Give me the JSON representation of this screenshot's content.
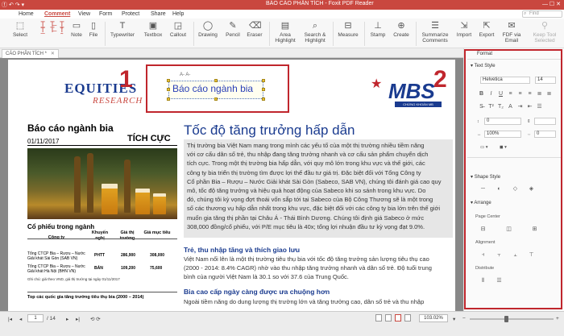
{
  "window": {
    "title": "BÁO CÁO PHÂN TÍCH - Foxit PDF Reader",
    "left_controls": "ⓕ ↶ ↷ ▾",
    "right_controls": "— ☐ ✕"
  },
  "menu": {
    "items": [
      "Home",
      "Comment",
      "View",
      "Form",
      "Protect",
      "Share",
      "Help"
    ],
    "active": "Comment",
    "find_placeholder": "Find"
  },
  "ribbon": {
    "buttons": [
      {
        "label": "Select",
        "icon": "cursor-icon"
      },
      {
        "label": "Note",
        "icon": "note-icon"
      },
      {
        "label": "File",
        "icon": "file-icon"
      },
      {
        "label": "Typewriter",
        "icon": "typewriter-icon"
      },
      {
        "label": "Textbox",
        "icon": "textbox-icon"
      },
      {
        "label": "Callout",
        "icon": "callout-icon"
      },
      {
        "label": "Drawing",
        "icon": "drawing-icon"
      },
      {
        "label": "Pencil",
        "icon": "pencil-icon"
      },
      {
        "label": "Eraser",
        "icon": "eraser-icon"
      },
      {
        "label": "Area Highlight",
        "icon": "area-highlight-icon"
      },
      {
        "label": "Search & Highlight",
        "icon": "search-highlight-icon"
      },
      {
        "label": "Measure",
        "icon": "measure-icon"
      },
      {
        "label": "Stamp",
        "icon": "stamp-icon"
      },
      {
        "label": "Create",
        "icon": "create-icon"
      },
      {
        "label": "Summarize Comments",
        "icon": "summarize-icon"
      },
      {
        "label": "Import",
        "icon": "import-icon"
      },
      {
        "label": "Export",
        "icon": "export-icon"
      },
      {
        "label": "FDF via Email",
        "icon": "email-icon"
      },
      {
        "label": "Keep Tool Selected",
        "icon": "keep-tool-icon"
      }
    ]
  },
  "tab": {
    "label": "CÁO PHÂN TÍCH *",
    "close": "✕"
  },
  "document": {
    "logo_left": "EQUITIES",
    "logo_left_sub": "RESEARCH",
    "annotation_number_1": "1",
    "annotation_number_2": "2",
    "annotation_font_controls": "A-  A-",
    "annotation_text": "Báo cáo ngành bia",
    "logo_right": "MBS",
    "logo_right_sub": "CHỨNG KHOÁN MB",
    "left_title": "Báo cáo ngành bia",
    "left_date": "01/11/2017",
    "left_rating": "TÍCH CỰC",
    "stock_heading": "Cổ phiếu trong ngành",
    "table": {
      "headers": [
        "Công ty",
        "Khuyến nghị",
        "Giá thị trường",
        "Giá mục tiêu"
      ],
      "rows": [
        {
          "company": "Tổng CTCP Bia – Rượu – Nước Giải khát Sài Gòn (SAB VN)",
          "rec": "PHTT",
          "price": "286,900",
          "target": "308,000"
        },
        {
          "company": "Tổng CTCP Bia – Rượu – Nước Giải khát Hà Nội (BHN VN)",
          "rec": "BÁN",
          "price": "109,200",
          "target": "75,600"
        }
      ],
      "note": "Ghi chú: giá theo VND, giá thị trường tại ngày 01/11/2017"
    },
    "top_heading": "Top các quốc gia tăng trưởng tiêu thụ bia (2000 – 2014)",
    "main_title": "Tốc độ tăng trưởng hấp dẫn",
    "intro_lines": [
      "Thị trường bia Việt Nam mang trong mình các yếu tố của một thị trường nhiều tiềm năng",
      "với cơ cấu dân số trẻ, thu nhập đang tăng trưởng nhanh và cơ cấu sản phẩm chuyển dịch",
      "tích cực. Trong một thị trường bia hấp dẫn, với quy mô lớn trong khu vực và thế giới, các",
      "công ty bia triển thị trường tìm được lợi thế đầu tư giá trị. Đặc biệt đối với Tổng Công ty",
      "Cổ phần Bia – Rượu – Nước Giải khát Sài Gòn (Sabeco, SAB VN), chúng tôi đánh giá cao quy",
      "mô, tốc độ tăng trưởng và hiệu quả hoạt động của Sabeco khi so sánh trong khu vực. Do",
      "đó, chúng tôi kỳ vọng đợt thoái vốn sắp tới tại Sabeco của Bộ Công Thương sẽ là một trong",
      "số các thương vụ hấp dẫn nhất trong khu vực, đặc biệt đối với các công ty bia lớn trên thế giới",
      "muốn gia tăng thị phần tại Châu Á - Thái Bình Dương. Chúng tôi định giá Sabeco ở mức",
      "308,000 đồng/cổ phiếu, với P/E mục tiêu là 40x; tổng lợi nhuận đầu tư kỳ vọng đạt 9.0%."
    ],
    "sub1": "Trẻ, thu nhập tăng và thích giao lưu",
    "sub1_lines": [
      "Việt Nam nổi lên là một thị trường tiêu thụ bia với tốc độ tăng trưởng sản lượng tiêu thụ cao",
      "(2000 - 2014: 8.4% CAGR) nhờ vào thu nhập tăng trưởng nhanh và dân số trẻ. Độ tuổi trung",
      "bình của người Việt Nam là 30.1 so với 37.6 của Trung Quốc."
    ],
    "sub2": "Bia cao cấp ngày càng được ưa chuộng hơn",
    "sub2_lines": [
      "Ngoài tiềm năng do dung lượng thị trường lớn và tăng trưởng cao, dân số trẻ và thu nhập"
    ]
  },
  "panel": {
    "tab": "Format",
    "text_style": "Text Style",
    "font": "Helvetica",
    "size": "14",
    "line_spacing": "0",
    "scale": "100%",
    "char_spacing": "0",
    "shape_style": "Shape Style",
    "arrange": "Arrange",
    "page_center": "Page Center",
    "alignment": "Alignment",
    "distribute": "Distribute"
  },
  "status": {
    "page_current": "1",
    "page_total": "/ 14",
    "zoom": "103.02%"
  }
}
